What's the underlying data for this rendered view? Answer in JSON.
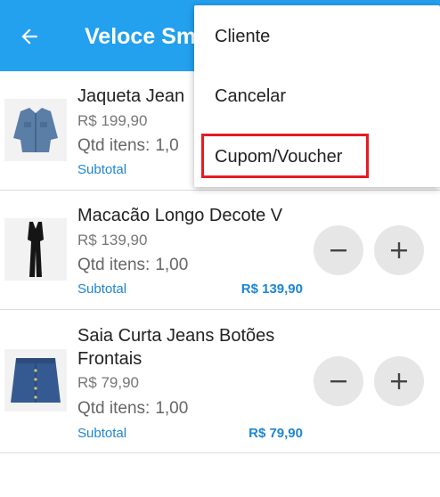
{
  "appbar": {
    "title": "Veloce Sm",
    "back_icon": "arrow-back-icon",
    "background": "#23a0ee"
  },
  "items": [
    {
      "name": "Jaqueta Jean",
      "price": "R$ 199,90",
      "qty_label": "Qtd itens:",
      "qty_value": "1,0",
      "subtotal_label": "Subtotal",
      "image": "denim-jacket-image"
    },
    {
      "name": "Macacão Longo Decote V",
      "price": "R$ 139,90",
      "qty_label": "Qtd itens:",
      "qty_value": "1,00",
      "subtotal_label": "Subtotal",
      "subtotal_value": "R$ 139,90",
      "image": "black-jumpsuit-image"
    },
    {
      "name": "Saia Curta Jeans Botões Frontais",
      "price": "R$ 79,90",
      "qty_label": "Qtd itens:",
      "qty_value": "1,00",
      "subtotal_label": "Subtotal",
      "subtotal_value": "R$ 79,90",
      "image": "denim-skirt-image"
    }
  ],
  "menu": {
    "items": [
      {
        "label": "Cliente"
      },
      {
        "label": "Cancelar"
      },
      {
        "label": "Cupom/Voucher"
      }
    ],
    "highlight_color": "#e51c23"
  },
  "accent_color": "#1e86d4"
}
